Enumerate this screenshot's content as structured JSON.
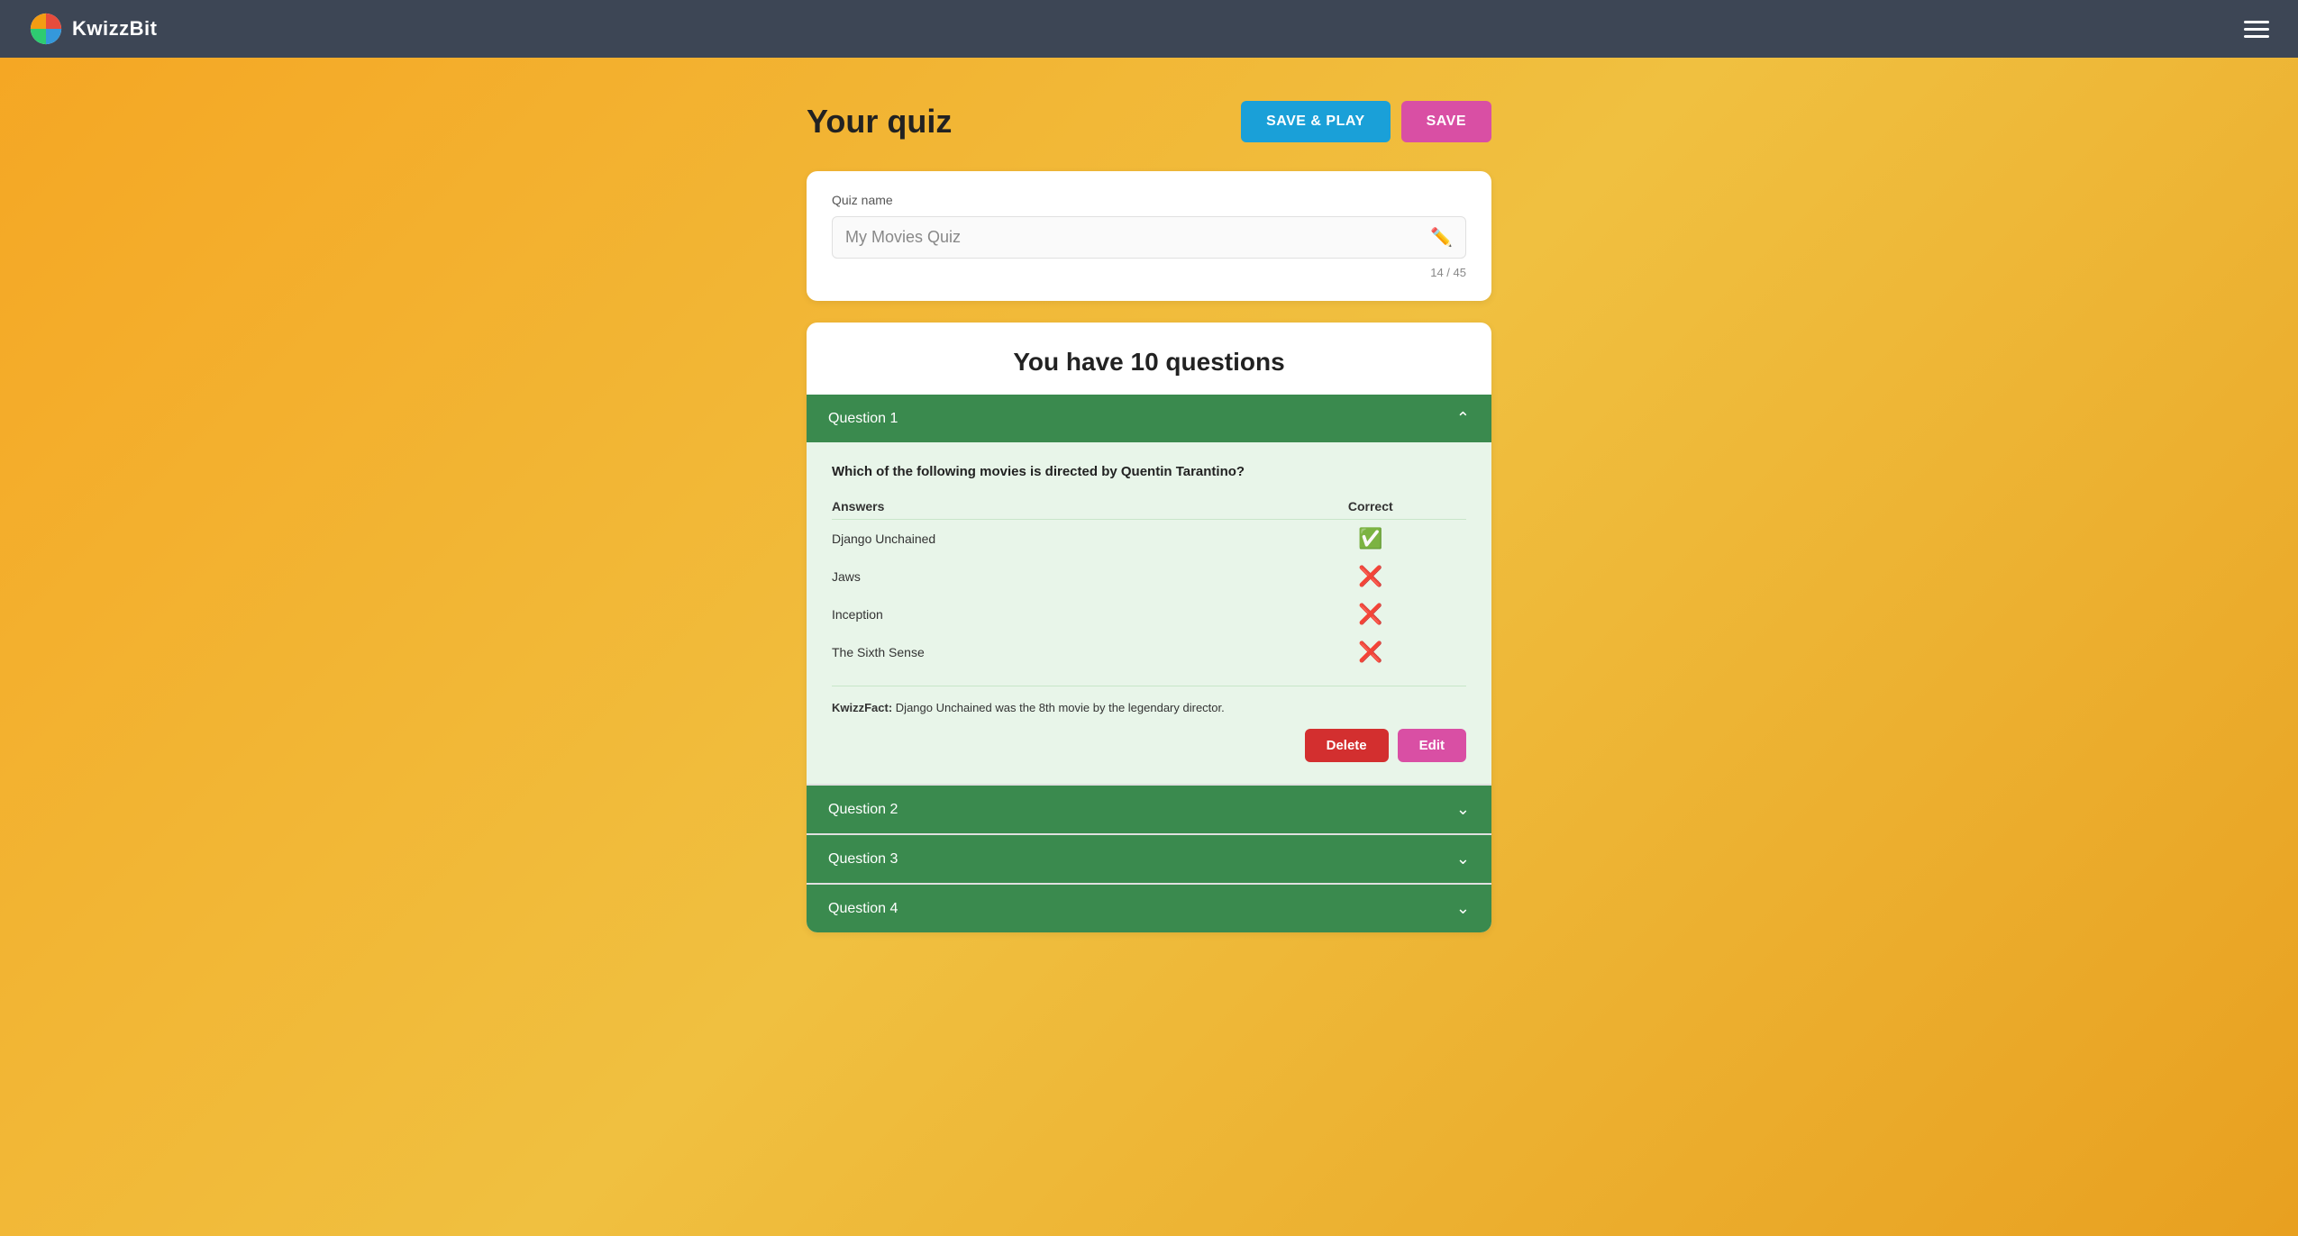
{
  "navbar": {
    "logo_text": "KwizzBit",
    "hamburger_label": "Menu"
  },
  "header": {
    "title": "Your quiz",
    "save_play_label": "SAVE & PLAY",
    "save_label": "SAVE"
  },
  "quiz_name_section": {
    "label": "Quiz name",
    "value": "My Movies Quiz",
    "char_count": "14 / 45"
  },
  "questions_section": {
    "title": "You have 10 questions",
    "questions": [
      {
        "id": 1,
        "label": "Question 1",
        "expanded": true,
        "question_text": "Which of the following movies is directed by Quentin Tarantino?",
        "answers_col": "Answers",
        "correct_col": "Correct",
        "answers": [
          {
            "text": "Django Unchained",
            "correct": true
          },
          {
            "text": "Jaws",
            "correct": false
          },
          {
            "text": "Inception",
            "correct": false
          },
          {
            "text": "The Sixth Sense",
            "correct": false
          }
        ],
        "kwizzfact_label": "KwizzFact:",
        "kwizzfact_text": "Django Unchained was the 8th movie by the legendary director.",
        "delete_label": "Delete",
        "edit_label": "Edit"
      },
      {
        "id": 2,
        "label": "Question 2",
        "expanded": false
      },
      {
        "id": 3,
        "label": "Question 3",
        "expanded": false
      },
      {
        "id": 4,
        "label": "Question 4",
        "expanded": false
      }
    ]
  },
  "colors": {
    "save_play_bg": "#1aa0d8",
    "save_bg": "#d94fa4",
    "question_bar_bg": "#3a8a4e",
    "correct_icon_color": "#2e7d32",
    "wrong_icon_color": "#c62828",
    "delete_bg": "#d32f2f",
    "edit_bg": "#d94fa4"
  }
}
